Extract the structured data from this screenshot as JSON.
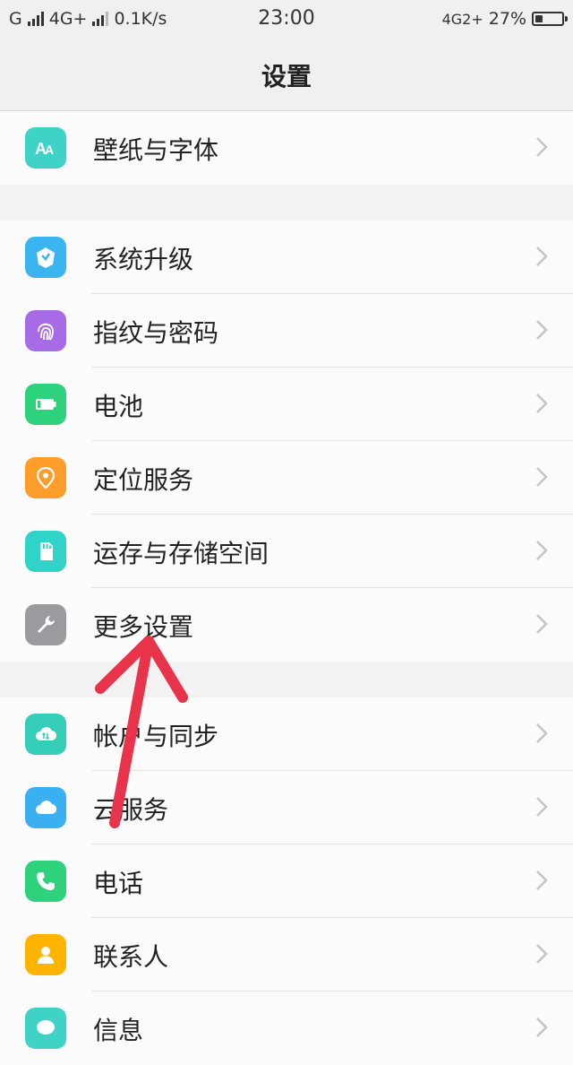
{
  "status_bar": {
    "carrier1": "G",
    "network1": "4G+",
    "speed": "0.1K/s",
    "time": "23:00",
    "network2": "4G2+",
    "battery_percent": "27%",
    "battery_level": 0.27
  },
  "header": {
    "title": "设置"
  },
  "groups": [
    {
      "items": [
        {
          "label": "壁纸与字体",
          "icon": "wallpaper-font-icon",
          "color": "#3fd2c7"
        }
      ]
    },
    {
      "items": [
        {
          "label": "系统升级",
          "icon": "system-update-icon",
          "color": "#3ab5f0"
        },
        {
          "label": "指纹与密码",
          "icon": "fingerprint-icon",
          "color": "#a86be8"
        },
        {
          "label": "电池",
          "icon": "battery-icon",
          "color": "#2ed27c"
        },
        {
          "label": "定位服务",
          "icon": "location-icon",
          "color": "#ff9d2b"
        },
        {
          "label": "运存与存储空间",
          "icon": "storage-icon",
          "color": "#2fd3c8"
        },
        {
          "label": "更多设置",
          "icon": "wrench-icon",
          "color": "#9a9a9f"
        }
      ]
    },
    {
      "items": [
        {
          "label": "帐户与同步",
          "icon": "account-sync-icon",
          "color": "#33cdb8"
        },
        {
          "label": "云服务",
          "icon": "cloud-icon",
          "color": "#3ab0f2"
        },
        {
          "label": "电话",
          "icon": "phone-icon",
          "color": "#2ed27c"
        },
        {
          "label": "联系人",
          "icon": "contacts-icon",
          "color": "#ffb400"
        },
        {
          "label": "信息",
          "icon": "message-icon",
          "color": "#3fd2c7"
        }
      ]
    }
  ],
  "annotation_color": "#e8334a"
}
